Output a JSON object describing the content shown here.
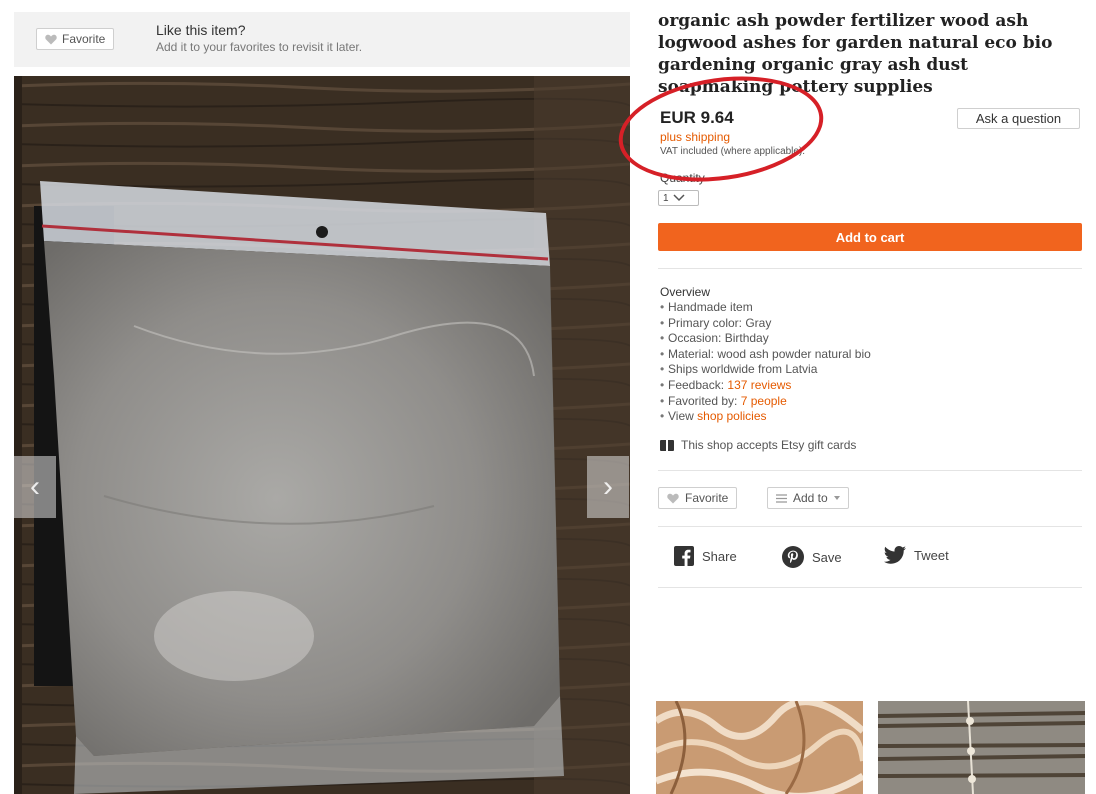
{
  "favorite_banner": {
    "button_label": "Favorite",
    "title": "Like this item?",
    "subtitle": "Add it to your favorites to revisit it later."
  },
  "listing": {
    "title": "organic ash powder fertilizer wood ash logwood ashes for garden natural eco bio gardening organic gray ash dust soapmaking pottery supplies",
    "price": "EUR 9.64",
    "shipping": "plus shipping",
    "vat": "VAT included (where applicable).",
    "ask_question": "Ask a question",
    "quantity_label": "Quantity",
    "quantity_value": "1",
    "add_to_cart": "Add to cart"
  },
  "overview": {
    "title": "Overview",
    "items": [
      "Handmade item",
      "Primary color: Gray",
      "Occasion: Birthday",
      "Material: wood ash powder natural bio",
      "Ships worldwide from Latvia"
    ],
    "feedback_prefix": "Feedback:",
    "feedback_link": "137 reviews",
    "favorited_prefix": "Favorited by:",
    "favorited_link": "7 people",
    "view_prefix": "View",
    "view_link": "shop policies",
    "gift_cards": "This shop accepts Etsy gift cards"
  },
  "actions": {
    "favorite": "Favorite",
    "add_to": "Add to"
  },
  "social": {
    "share": "Share",
    "save": "Save",
    "tweet": "Tweet"
  },
  "colors": {
    "accent": "#f1641e",
    "link": "#e55a00",
    "annotation_circle": "#d62027"
  }
}
